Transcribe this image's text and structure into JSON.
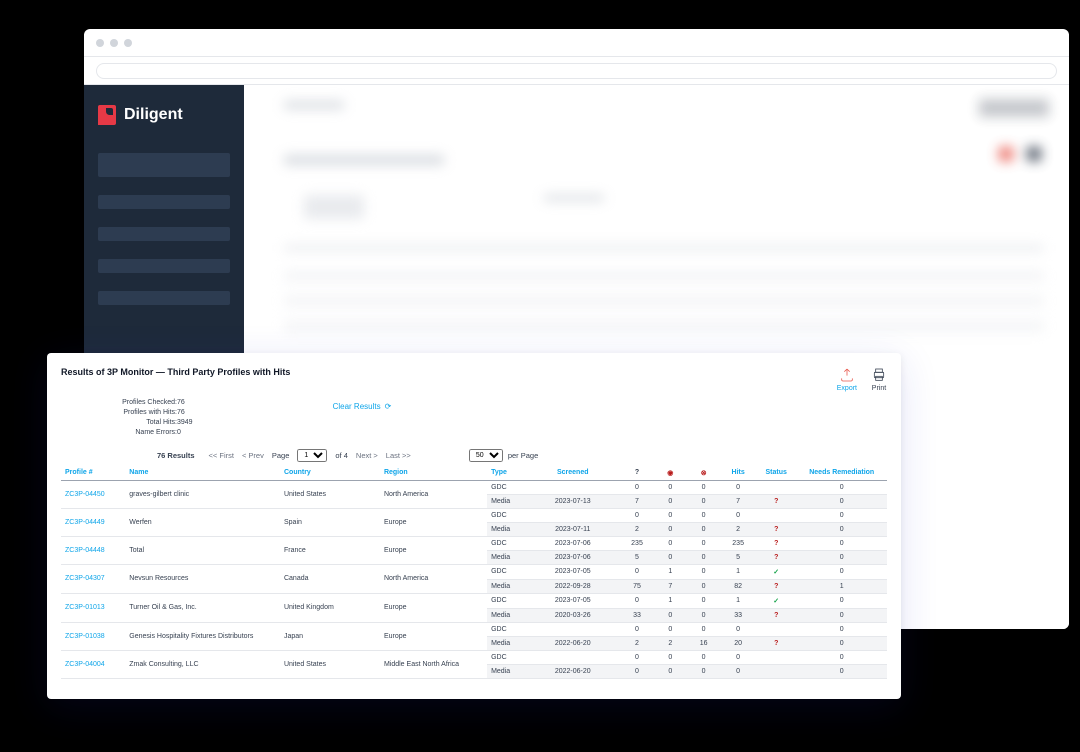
{
  "brand": "Diligent",
  "report": {
    "title": "Results of 3P Monitor — Third Party Profiles with Hits",
    "actions": {
      "export": "Export",
      "print": "Print"
    },
    "stats": {
      "profiles_checked_label": "Profiles Checked:",
      "profiles_checked": "76",
      "profiles_hits_label": "Profiles with Hits:",
      "profiles_hits": "76",
      "total_hits_label": "Total Hits:",
      "total_hits": "3949",
      "name_errors_label": "Name Errors:",
      "name_errors": "0"
    },
    "clear": "Clear Results",
    "pagination": {
      "count": "76 Results",
      "first": "<< First",
      "prev": "< Prev",
      "page_label": "Page",
      "page": "1",
      "of": "of 4",
      "next": "Next >",
      "last": "Last >>",
      "per_page_value": "50",
      "per_page_label": "per Page"
    },
    "headers": {
      "profile": "Profile #",
      "name": "Name",
      "country": "Country",
      "region": "Region",
      "type": "Type",
      "screened": "Screened",
      "q": "?",
      "circ": "●",
      "xx": "⊗",
      "hits": "Hits",
      "status": "Status",
      "remediation": "Needs Remediation"
    },
    "rows": [
      {
        "profile": "ZC3P-04450",
        "name": "graves-gilbert clinic",
        "country": "United States",
        "region": "North America",
        "sub": [
          {
            "type": "GDC",
            "screened": "",
            "q": "0",
            "c": "0",
            "x": "0",
            "hits": "0",
            "status": "",
            "rem": "0"
          },
          {
            "type": "Media",
            "screened": "2023-07-13",
            "q": "7",
            "c": "0",
            "x": "0",
            "hits": "7",
            "status": "?",
            "rem": "0"
          }
        ]
      },
      {
        "profile": "ZC3P-04449",
        "name": "Werfen",
        "country": "Spain",
        "region": "Europe",
        "sub": [
          {
            "type": "GDC",
            "screened": "",
            "q": "0",
            "c": "0",
            "x": "0",
            "hits": "0",
            "status": "",
            "rem": "0"
          },
          {
            "type": "Media",
            "screened": "2023-07-11",
            "q": "2",
            "c": "0",
            "x": "0",
            "hits": "2",
            "status": "?",
            "rem": "0"
          }
        ]
      },
      {
        "profile": "ZC3P-04448",
        "name": "Total",
        "country": "France",
        "region": "Europe",
        "sub": [
          {
            "type": "GDC",
            "screened": "2023-07-06",
            "q": "235",
            "c": "0",
            "x": "0",
            "hits": "235",
            "status": "?",
            "rem": "0"
          },
          {
            "type": "Media",
            "screened": "2023-07-06",
            "q": "5",
            "c": "0",
            "x": "0",
            "hits": "5",
            "status": "?",
            "rem": "0"
          }
        ]
      },
      {
        "profile": "ZC3P-04307",
        "name": "Nevsun Resources",
        "country": "Canada",
        "region": "North America",
        "sub": [
          {
            "type": "GDC",
            "screened": "2023-07-05",
            "q": "0",
            "c": "1",
            "x": "0",
            "hits": "1",
            "status": "✓",
            "rem": "0"
          },
          {
            "type": "Media",
            "screened": "2022-09-28",
            "q": "75",
            "c": "7",
            "x": "0",
            "hits": "82",
            "status": "?",
            "rem": "1"
          }
        ]
      },
      {
        "profile": "ZC3P-01013",
        "name": "Turner Oil & Gas, Inc.",
        "country": "United Kingdom",
        "region": "Europe",
        "sub": [
          {
            "type": "GDC",
            "screened": "2023-07-05",
            "q": "0",
            "c": "1",
            "x": "0",
            "hits": "1",
            "status": "✓",
            "rem": "0"
          },
          {
            "type": "Media",
            "screened": "2020-03-26",
            "q": "33",
            "c": "0",
            "x": "0",
            "hits": "33",
            "status": "?",
            "rem": "0"
          }
        ]
      },
      {
        "profile": "ZC3P-01038",
        "name": "Genesis Hospitality Fixtures Distributors",
        "country": "Japan",
        "region": "Europe",
        "sub": [
          {
            "type": "GDC",
            "screened": "",
            "q": "0",
            "c": "0",
            "x": "0",
            "hits": "0",
            "status": "",
            "rem": "0"
          },
          {
            "type": "Media",
            "screened": "2022-06-20",
            "q": "2",
            "c": "2",
            "x": "16",
            "hits": "20",
            "status": "?",
            "rem": "0"
          }
        ]
      },
      {
        "profile": "ZC3P-04004",
        "name": "Zmak Consulting, LLC",
        "country": "United States",
        "region": "Middle East North Africa",
        "sub": [
          {
            "type": "GDC",
            "screened": "",
            "q": "0",
            "c": "0",
            "x": "0",
            "hits": "0",
            "status": "",
            "rem": "0"
          },
          {
            "type": "Media",
            "screened": "2022-06-20",
            "q": "0",
            "c": "0",
            "x": "0",
            "hits": "0",
            "status": "",
            "rem": "0"
          }
        ]
      }
    ]
  }
}
